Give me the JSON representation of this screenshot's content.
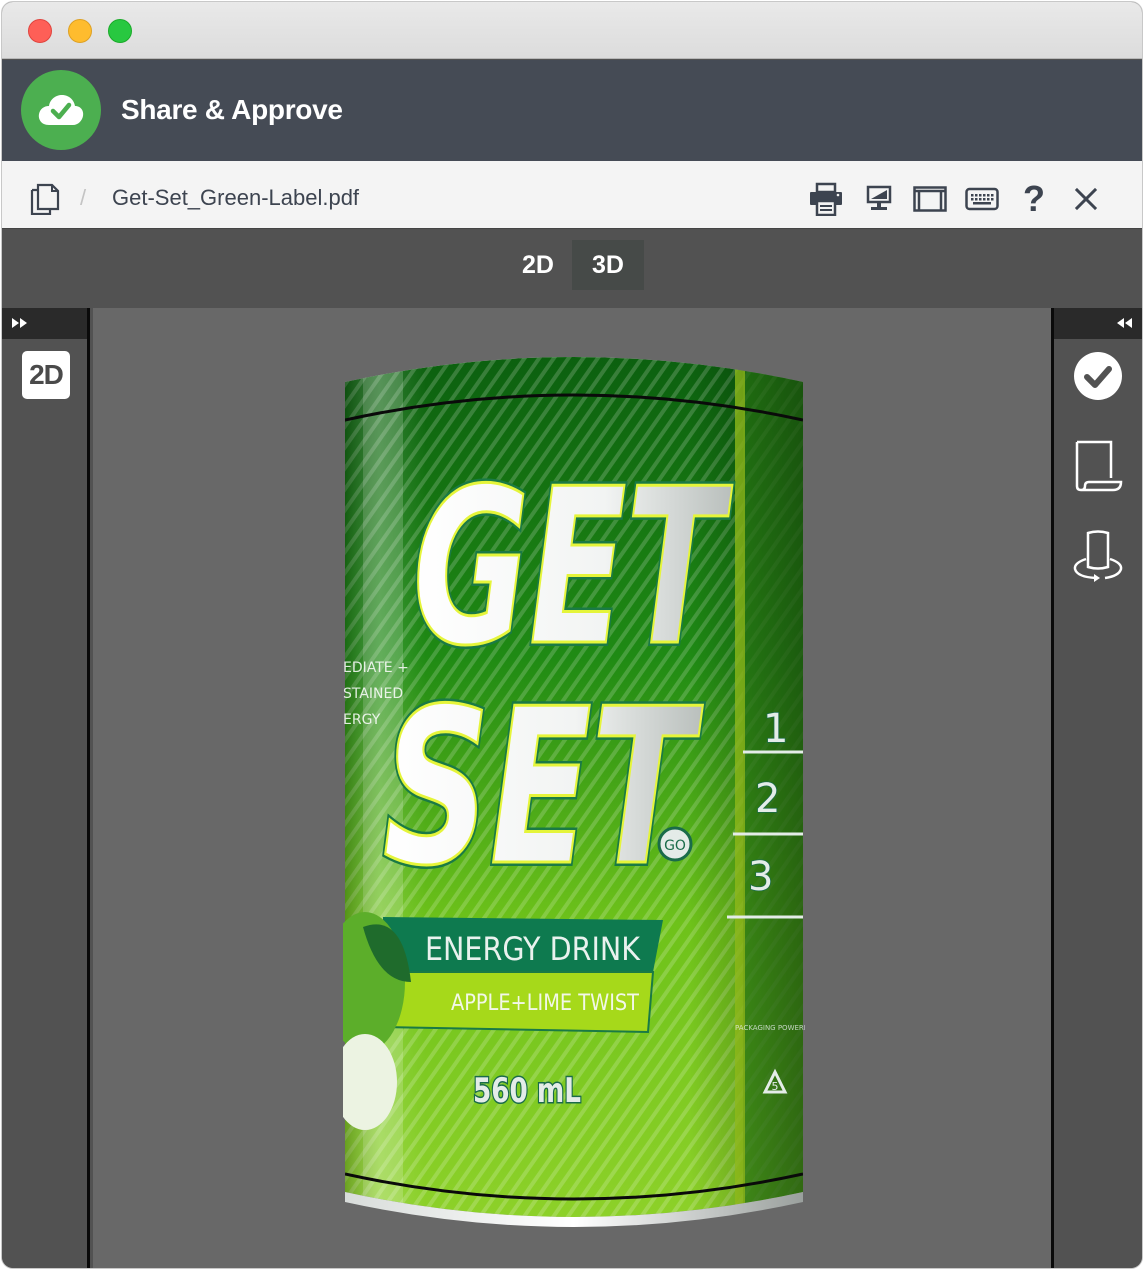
{
  "window": {
    "controls": [
      "close",
      "minimize",
      "maximize"
    ]
  },
  "app": {
    "title": "Share & Approve",
    "logo_icon": "cloud-check-icon",
    "brand_color": "#4caf50"
  },
  "toolbar": {
    "breadcrumb_icon": "documents-icon",
    "separator": "/",
    "filename": "Get-Set_Green-Label.pdf",
    "buttons": [
      {
        "name": "print",
        "icon": "printer-icon"
      },
      {
        "name": "present",
        "icon": "monitor-icon"
      },
      {
        "name": "layout",
        "icon": "panel-layout-icon"
      },
      {
        "name": "keyboard-shortcuts",
        "icon": "keyboard-icon"
      },
      {
        "name": "help",
        "icon": "question-icon",
        "label": "?"
      },
      {
        "name": "close",
        "icon": "close-icon",
        "label": "✕"
      }
    ]
  },
  "view_modes": {
    "options": [
      "2D",
      "3D"
    ],
    "selected": "3D"
  },
  "left_sidebar": {
    "expand_icon": "fast-forward-icon",
    "badge": "2D"
  },
  "right_sidebar": {
    "collapse_icon": "rewind-icon",
    "tools": [
      {
        "name": "approve",
        "icon": "check-circle-icon"
      },
      {
        "name": "label-shape",
        "icon": "scroll-page-icon"
      },
      {
        "name": "rotate-3d",
        "icon": "rotate-cylinder-icon"
      }
    ]
  },
  "product": {
    "brand_line1": "GET",
    "brand_line2": "SET",
    "go_badge": "GO",
    "product_type": "ENERGY DRINK",
    "flavor": "APPLE+LIME TWIST",
    "volume": "560 mL",
    "side_text": [
      "EDIATE +",
      "STAINED",
      "ERGY"
    ],
    "steps": [
      "1",
      "2",
      "3"
    ],
    "recycle_code": "5",
    "packaging_note": "PACKAGING POWERED BY"
  }
}
